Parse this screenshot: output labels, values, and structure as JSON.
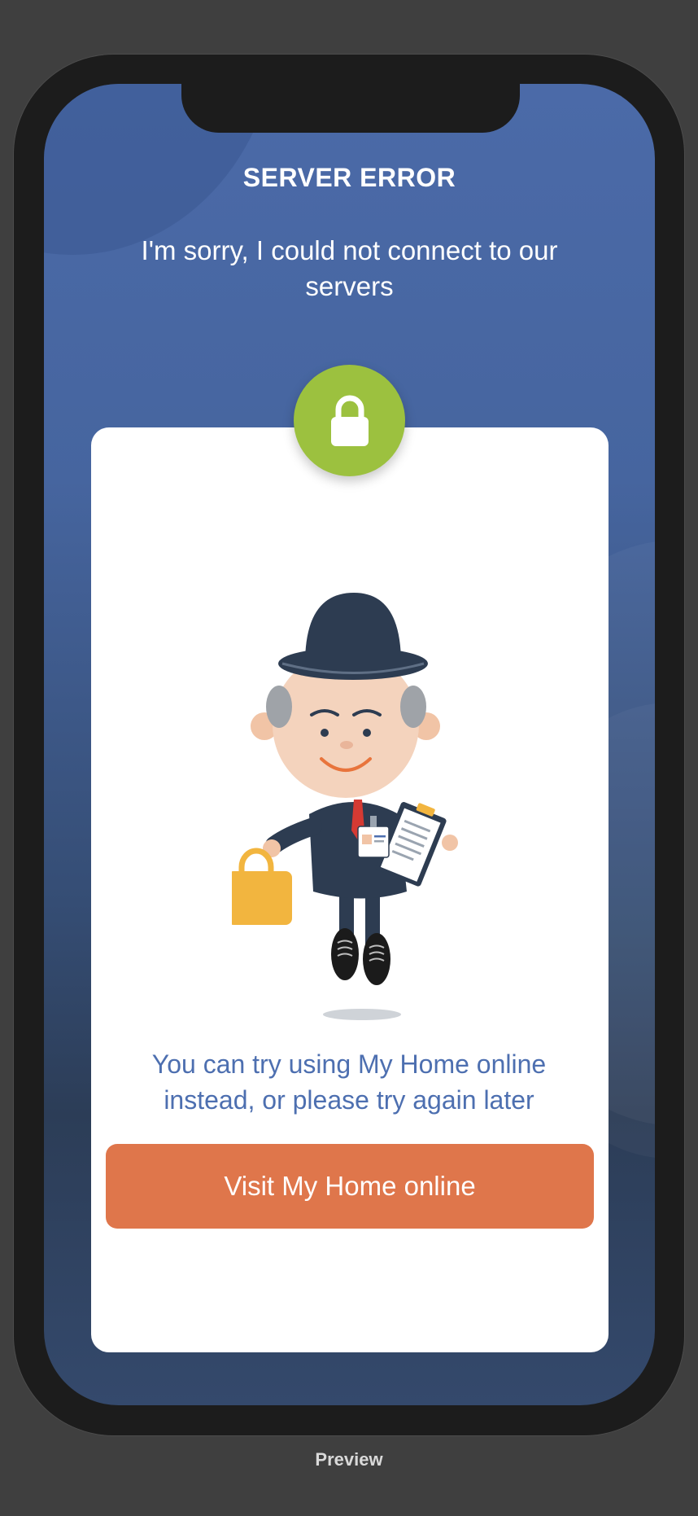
{
  "error": {
    "title": "SERVER ERROR",
    "message": "I'm sorry, I could not connect to our servers"
  },
  "card": {
    "message": "You can try using My Home online instead, or please try again later",
    "button_label": "Visit My Home online"
  },
  "footer": {
    "label": "Preview"
  },
  "icons": {
    "badge": "lock-icon",
    "mascot": "mascot-illustration"
  },
  "colors": {
    "background_top": "#4b6aa8",
    "background_bottom": "#2c3d57",
    "badge_green": "#9cc13f",
    "button_orange": "#df764b",
    "card_text_blue": "#4d6fb0"
  }
}
